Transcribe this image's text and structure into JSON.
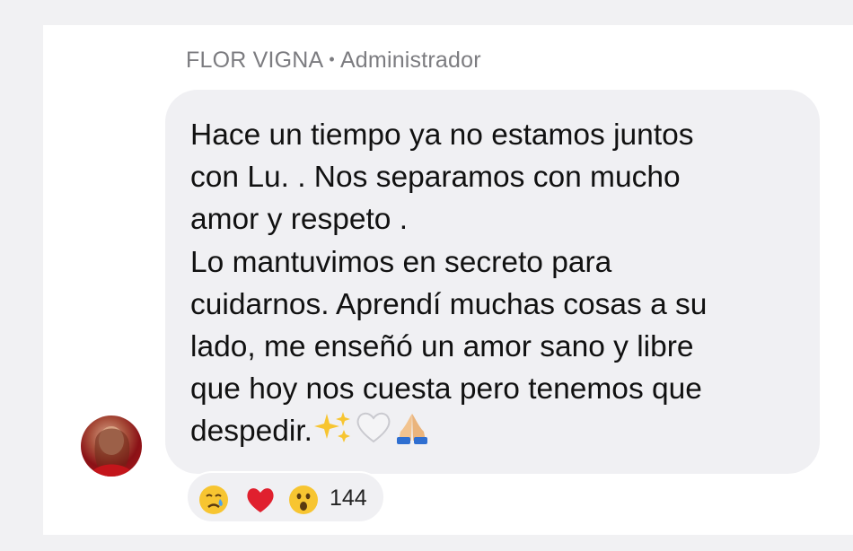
{
  "post": {
    "author": "FLOR VIGNA",
    "separator": "•",
    "role": "Administrador",
    "message_lines": [
      "Hace un tiempo ya no estamos juntos",
      "con Lu. . Nos separamos con mucho",
      "amor y respeto .",
      "Lo mantuvimos en secreto para",
      "cuidarnos. Aprendí muchas cosas a su",
      "lado, me enseñó un amor sano y libre",
      "que hoy nos cuesta pero tenemos que",
      "despedir."
    ],
    "message_trailing_emojis": [
      "sparkles-emoji",
      "white-heart-emoji",
      "folded-hands-emoji"
    ]
  },
  "reactions": {
    "icons": [
      "crying-face-icon",
      "red-heart-icon",
      "surprised-face-icon"
    ],
    "count": "144"
  },
  "colors": {
    "bubble": "#f0f0f3",
    "sender_text": "#7c7c80",
    "heart": "#e0202e"
  }
}
